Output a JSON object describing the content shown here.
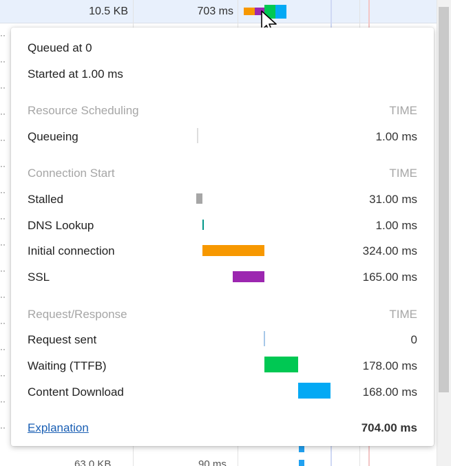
{
  "background_row": {
    "size": "10.5 KB",
    "time": "703 ms"
  },
  "bottom_row": {
    "size": "63.0 KB",
    "time": "90 ms"
  },
  "popup": {
    "queued_at": "Queued at 0",
    "started_at": "Started at 1.00 ms",
    "sections": [
      {
        "title": "Resource Scheduling",
        "time_header": "TIME",
        "rows": [
          {
            "label": "Queueing",
            "value": "1.00 ms",
            "color": "#cccccc"
          }
        ]
      },
      {
        "title": "Connection Start",
        "time_header": "TIME",
        "rows": [
          {
            "label": "Stalled",
            "value": "31.00 ms",
            "color": "#a6a6a6"
          },
          {
            "label": "DNS Lookup",
            "value": "1.00 ms",
            "color": "#009688"
          },
          {
            "label": "Initial connection",
            "value": "324.00 ms",
            "color": "#f79800"
          },
          {
            "label": "SSL",
            "value": "165.00 ms",
            "color": "#9c27b0"
          }
        ]
      },
      {
        "title": "Request/Response",
        "time_header": "TIME",
        "rows": [
          {
            "label": "Request sent",
            "value": "0",
            "color": "#a6c8e8"
          },
          {
            "label": "Waiting (TTFB)",
            "value": "178.00 ms",
            "color": "#00c853"
          },
          {
            "label": "Content Download",
            "value": "168.00 ms",
            "color": "#03a9f4"
          }
        ]
      }
    ],
    "explanation_link": "Explanation",
    "total": "704.00 ms"
  },
  "icons": {
    "cursor": "mouse-pointer-icon"
  }
}
